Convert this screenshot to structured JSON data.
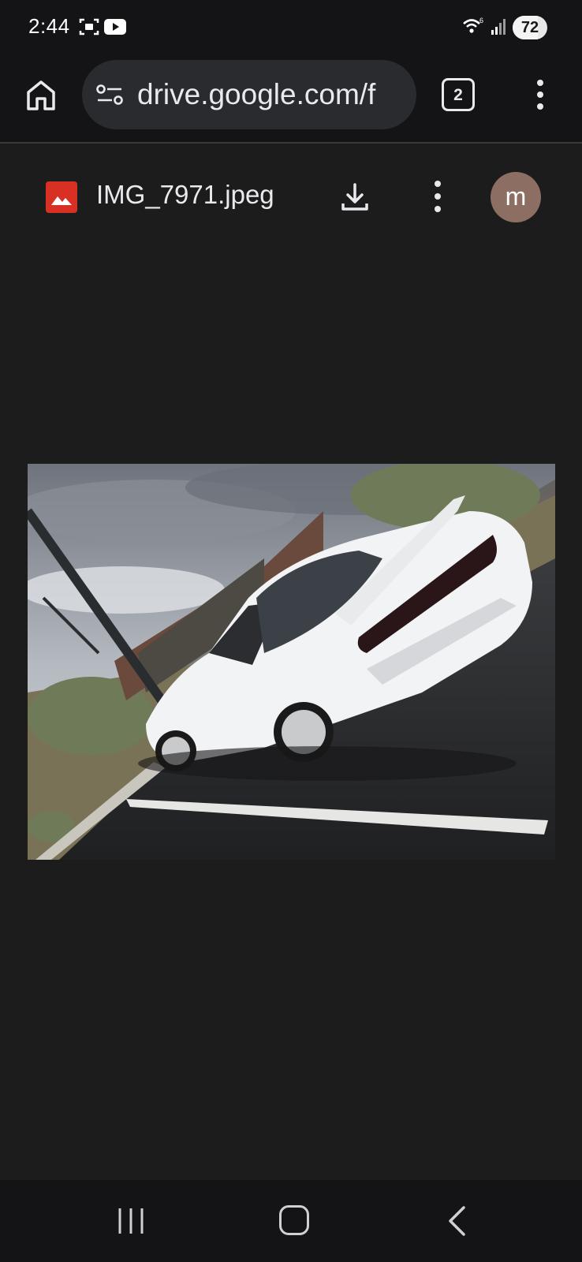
{
  "status_bar": {
    "time": "2:44",
    "battery_level": "72",
    "icons": [
      "screenshot-icon",
      "youtube-icon",
      "wifi-6-icon",
      "signal-icon",
      "battery-icon"
    ]
  },
  "browser": {
    "url": "drive.google.com/f",
    "tab_count": "2",
    "icons": [
      "home-icon",
      "site-info-icon",
      "tab-switcher-icon",
      "more-vert-icon"
    ]
  },
  "viewer": {
    "file_name": "IMG_7971.jpeg",
    "avatar_initial": "m",
    "icons": [
      "image-file-icon",
      "download-icon",
      "more-vert-icon"
    ]
  },
  "photo": {
    "subject": "white sports car",
    "colors": {
      "sky": "#9aa0a8",
      "car": "#f2f3f4",
      "asphalt": "#2e2f31",
      "sign": "#6a4a3c",
      "brush": "#6f7a58"
    }
  },
  "nav_bar": {
    "icons": [
      "recents-icon",
      "home-icon",
      "back-icon"
    ]
  },
  "colors": {
    "status_bg": "#141416",
    "page_bg": "#1c1c1c",
    "omnibox_bg": "#2a2b2f",
    "file_icon": "#d93025",
    "avatar": "#8d6e63"
  }
}
